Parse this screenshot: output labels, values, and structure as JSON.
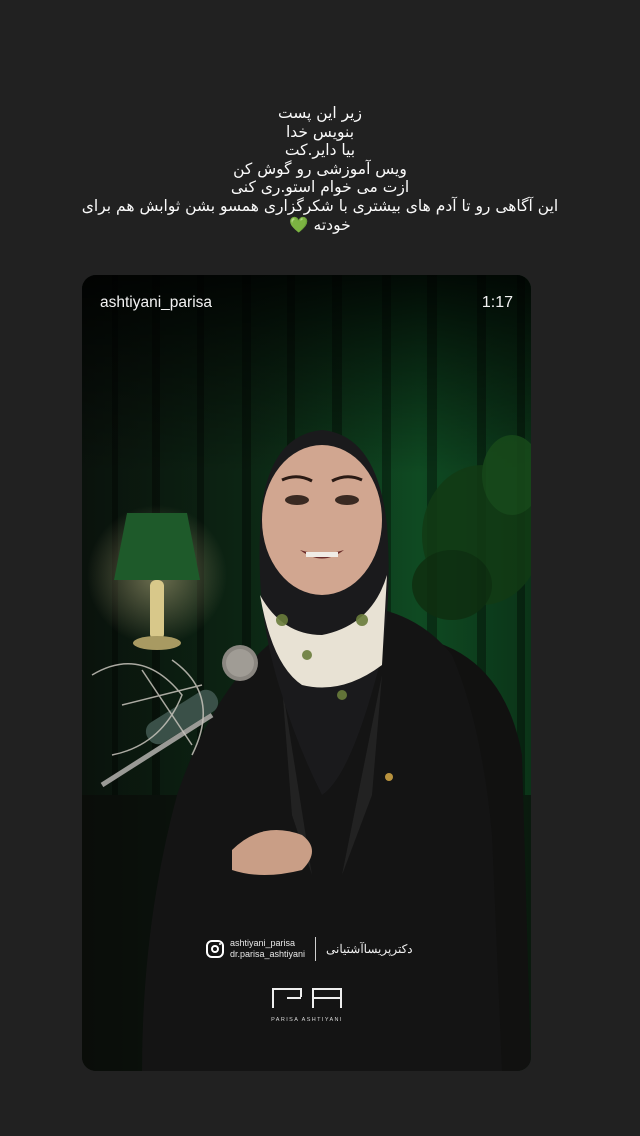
{
  "caption": {
    "lines": [
      "زیر این پست",
      "بنویس خدا",
      "بیا دایر.کت",
      "ویس آموزشی رو گوش کن",
      "ازت می خوام استو.ری کنی",
      "این آگاهی رو تا آدم های بیشتری با شکرگزاری همسو بشن ثوابش هم برای",
      "خودته 💚"
    ]
  },
  "story": {
    "username": "ashtiyani_parisa",
    "duration": "1:17",
    "watermark": {
      "instagram_icon": "instagram-icon",
      "handle_1": "ashtiyani_parisa",
      "handle_2": "dr.parisa_ashtiyani",
      "persian_name": "دکترپریساآشتیانی",
      "logo_text": "PARISA ASHTIYANI"
    }
  },
  "colors": {
    "background": "#212121",
    "curtain": "#0f3a1c",
    "text": "#ffffff"
  }
}
